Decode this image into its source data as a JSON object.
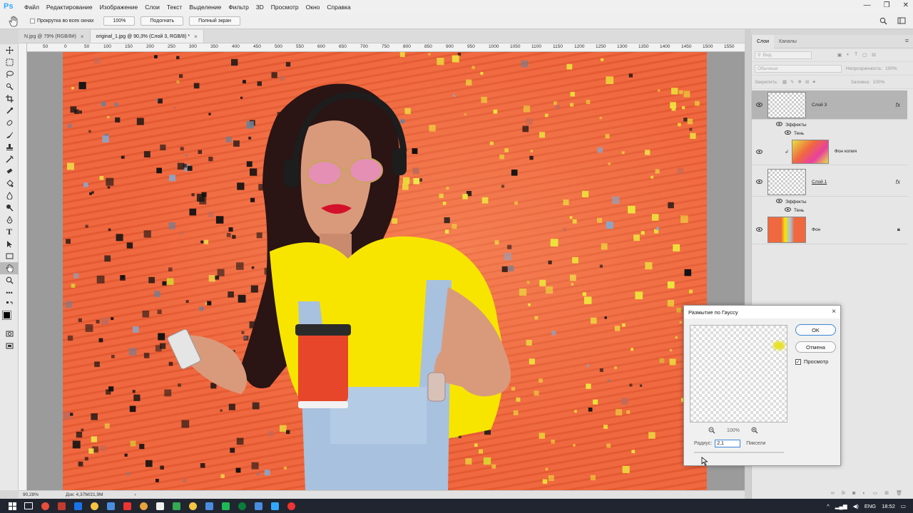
{
  "app": {
    "logo": "Ps",
    "window_controls": [
      "—",
      "❐",
      "✕"
    ]
  },
  "menu": [
    "Файл",
    "Редактирование",
    "Изображение",
    "Слои",
    "Текст",
    "Выделение",
    "Фильтр",
    "3D",
    "Просмотр",
    "Окно",
    "Справка"
  ],
  "options": {
    "scroll_all_label": "Прокрутка во всех окнах",
    "zoom_value": "100%",
    "fit_label": "Подогнать",
    "fullscreen_label": "Полный экран"
  },
  "tabs": [
    {
      "label": "N.jpg @ 79% (RGB/8#)"
    },
    {
      "label": "original_1.jpg @ 90,3% (Слой 3, RGB/8) *"
    }
  ],
  "ruler_ticks": [
    "50",
    "0",
    "50",
    "100",
    "150",
    "200",
    "250",
    "300",
    "350",
    "400",
    "450",
    "500",
    "550",
    "600",
    "650",
    "700",
    "750",
    "800",
    "850",
    "900",
    "950",
    "1000",
    "1050",
    "1100",
    "1150",
    "1200",
    "1250",
    "1300",
    "1350",
    "1400",
    "1450",
    "1500",
    "1550"
  ],
  "status": {
    "zoom": "90,28%",
    "doc": "Док: 4,37M/21,9M"
  },
  "layers_panel": {
    "tab_layers": "Слои",
    "tab_channels": "Каналы",
    "search_placeholder": "Вид",
    "blend_mode": "Обычные",
    "opacity_label": "Непрозрачность:",
    "opacity_value": "100%",
    "lock_label": "Закрепить:",
    "fill_label": "Заливка:",
    "fill_value": "100%",
    "layers": [
      {
        "name": "Слой 3",
        "fx": "fx",
        "effects_label": "Эффекты",
        "effect": "Тень"
      },
      {
        "name": "Фон копия"
      },
      {
        "name": "Слой 1",
        "fx": "fx",
        "effects_label": "Эффекты",
        "effect": "Тень"
      },
      {
        "name": "Фон"
      }
    ]
  },
  "dialog": {
    "title": "Размытие по Гауссу",
    "ok_label": "OK",
    "cancel_label": "Отмена",
    "preview_label": "Просмотр",
    "preview_checked": true,
    "zoom_level": "100%",
    "radius_label": "Радиус:",
    "radius_value": "2,1",
    "radius_unit": "Пиксели"
  },
  "taskbar": {
    "lang": "ENG",
    "time": "18:52",
    "app_colors": [
      "#e84d3d",
      "#c23b2f",
      "#1a73e8",
      "#f5c542",
      "#4a8de0",
      "#e33",
      "#e8a33c",
      "#f0f0f0",
      "#34a853",
      "#f5c542",
      "#4a8de0",
      "#1db954",
      "#0a7d3a",
      "#4a8de0",
      "#31a8ff",
      "#e33"
    ]
  },
  "colors": {
    "accent": "#3d86d9",
    "ps_blue": "#31a8ff",
    "canvas_orange": "#f0683f",
    "shirt_yellow": "#f7e500"
  }
}
